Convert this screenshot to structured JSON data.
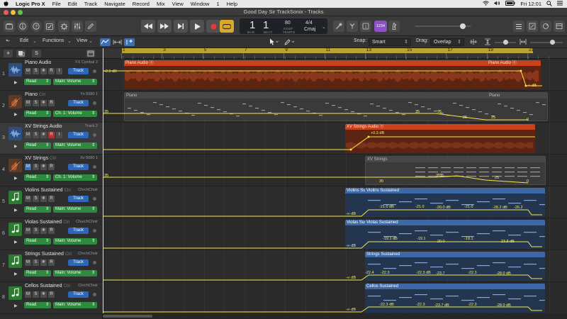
{
  "menubar": {
    "apple": "",
    "app": "Logic Pro X",
    "items": [
      "File",
      "Edit",
      "Track",
      "Navigate",
      "Record",
      "Mix",
      "View",
      "Window",
      "1",
      "Help"
    ],
    "clock": "Fri 12:01"
  },
  "window": {
    "title": "Good Day Sir TrackSonix - Tracks"
  },
  "lcd": {
    "bar": "1",
    "beat": "1",
    "bar_label": "BAR",
    "beat_label": "BEAT",
    "tempo": "80",
    "keep_label": "KEEP",
    "tempo_label": "TEMPO",
    "signature": "4/4",
    "key": "Cmaj"
  },
  "controlbar": {
    "counter": "1234"
  },
  "toolbar": {
    "edit": "Edit",
    "functions": "Functions",
    "view": "View",
    "snap_label": "Snap:",
    "snap_value": "Smart",
    "drag_label": "Drag:",
    "drag_value": "Overlap"
  },
  "ruler": [
    "1",
    "3",
    "5",
    "7",
    "9",
    "11",
    "13",
    "15",
    "17",
    "19",
    "21"
  ],
  "tracks": [
    {
      "num": "1",
      "name": "Piano Audio",
      "channel": "FX Cymbal 2",
      "button": "Track",
      "read": "Read",
      "auto": "Main: Volume"
    },
    {
      "num": "2",
      "name": "Piano",
      "ctrl": "Ctrl",
      "channel": "Yx 5080 1",
      "button": "Track",
      "read": "Read",
      "auto": "Ch. 1: Volume"
    },
    {
      "num": "3",
      "name": "XV Strings Audio",
      "channel": "Track 2",
      "button": "Track",
      "read": "Read",
      "auto": "Main: Volume"
    },
    {
      "num": "4",
      "name": "XV Strings",
      "ctrl": "Ctrl",
      "channel": "Xv 5080 1",
      "button": "Track",
      "read": "Read",
      "auto": "Ch. 1: Volume"
    },
    {
      "num": "5",
      "name": "Violins Sustained",
      "ctrl": "Ctrl",
      "channel": "ChrchChoir",
      "button": "Track",
      "read": "Read",
      "auto": "Main: Volume"
    },
    {
      "num": "6",
      "name": "Violas Sustained",
      "ctrl": "Ctrl",
      "channel": "ChurchChoir",
      "button": "Track",
      "read": "Read",
      "auto": "Main: Volume"
    },
    {
      "num": "7",
      "name": "Strings Sustained",
      "ctrl": "Ctrl",
      "channel": "ChrchChoir",
      "button": "Track",
      "read": "Read",
      "auto": "Main: Volume"
    },
    {
      "num": "8",
      "name": "Cellos Sustained",
      "ctrl": "Ctrl",
      "channel": "ChrchChoir",
      "button": "Track",
      "read": "Read",
      "auto": "Main: Volume"
    }
  ],
  "regions": {
    "piano_audio": "Piano Audio",
    "piano_audio_2": "Piano Audio",
    "piano_audio_db_start": "-2.1 dB",
    "piano_audio_db_end": "-∞ dB",
    "piano": "Piano",
    "piano_2": "Piano",
    "xv_audio": "XV Strings Audio",
    "xv_audio_db": "+0.3 dB",
    "xv_strings": "XV Strings",
    "violins": "Violins Sustained",
    "violins_short": "Violins Sust",
    "violas": "Violas Sustained",
    "violas_short": "Violas Sus",
    "strings": "Strings Sustained",
    "cellos": "Cellos Sustained"
  },
  "automation": {
    "piano": [
      "35",
      "35",
      "35",
      "25",
      "25",
      "0"
    ],
    "xv_strings": [
      "35",
      "35",
      "35",
      "35",
      "25",
      "0"
    ],
    "violins": [
      "-∞ dB",
      "-21.0 dB",
      "-21.0",
      "-20.0 dB",
      "-21.0",
      "-28.2 dB",
      "-26.2"
    ],
    "violas": [
      "-∞ dB",
      "-19.1 dB",
      "-19.1",
      "-20.0",
      "-19.1",
      "-23.8 dB"
    ],
    "strings": [
      "-∞ dB",
      "-22.4",
      "-22.3",
      "-22.3 dB",
      "-23.7",
      "-22.3",
      "-28.0 dB"
    ],
    "cellos": [
      "-∞ dB",
      "-22.3 dB",
      "-22.3",
      "-23.7 dB",
      "-22.3",
      "-28.0 dB"
    ]
  },
  "colors": {
    "region_orange": "#c8421d",
    "region_blue": "#3c68a5",
    "region_grey": "#4a4a4a",
    "automation": "#f2e84c",
    "cycle": "#b9a333",
    "read_green": "#2d8a3e",
    "track_blue": "#2e66b8"
  }
}
